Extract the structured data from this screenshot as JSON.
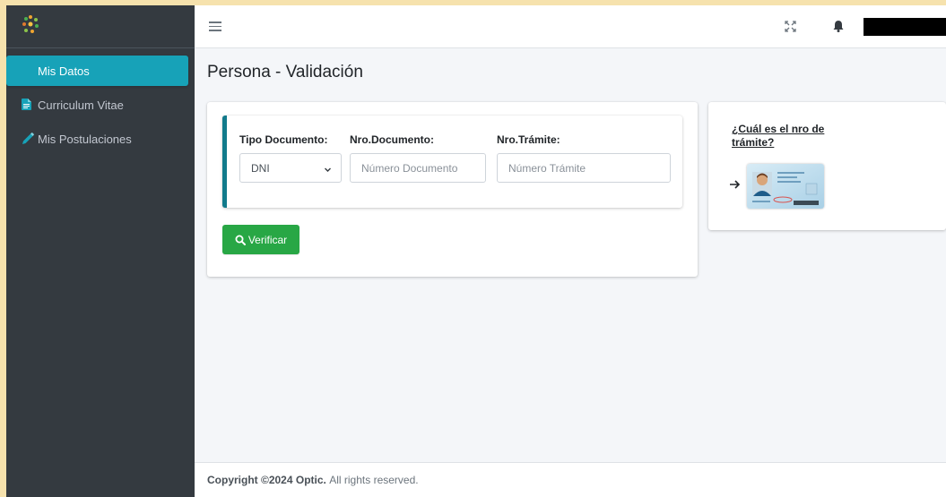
{
  "sidebar": {
    "logo_icon": "sparkle-logo",
    "items": [
      {
        "label": "Mis Datos",
        "active": true
      },
      {
        "label": "Curriculum Vitae",
        "icon": "document-icon"
      },
      {
        "label": "Mis Postulaciones",
        "icon": "pencil-icon"
      }
    ]
  },
  "topbar": {
    "menu_icon": "hamburger-icon",
    "fullscreen_icon": "expand-icon",
    "notifications_icon": "bell-icon"
  },
  "page": {
    "title": "Persona - Validación"
  },
  "form": {
    "tipo_documento_label": "Tipo Documento:",
    "tipo_documento_value": "DNI",
    "nro_documento_label": "Nro.Documento:",
    "nro_documento_placeholder": "Número Documento",
    "nro_tramite_label": "Nro.Trámite:",
    "nro_tramite_placeholder": "Número Trámite",
    "verify_button": "Verificar"
  },
  "help": {
    "link_text": "¿Cuál es el nro de trámite?"
  },
  "footer": {
    "copyright": "Copyright ©2024 Optic.",
    "rights": "All rights reserved."
  },
  "colors": {
    "sidebar_bg": "#343a40",
    "active_item": "#17a2b8",
    "callout_border": "#117a8b",
    "verify_button": "#28a745",
    "outer_background": "#f6e2ad"
  }
}
